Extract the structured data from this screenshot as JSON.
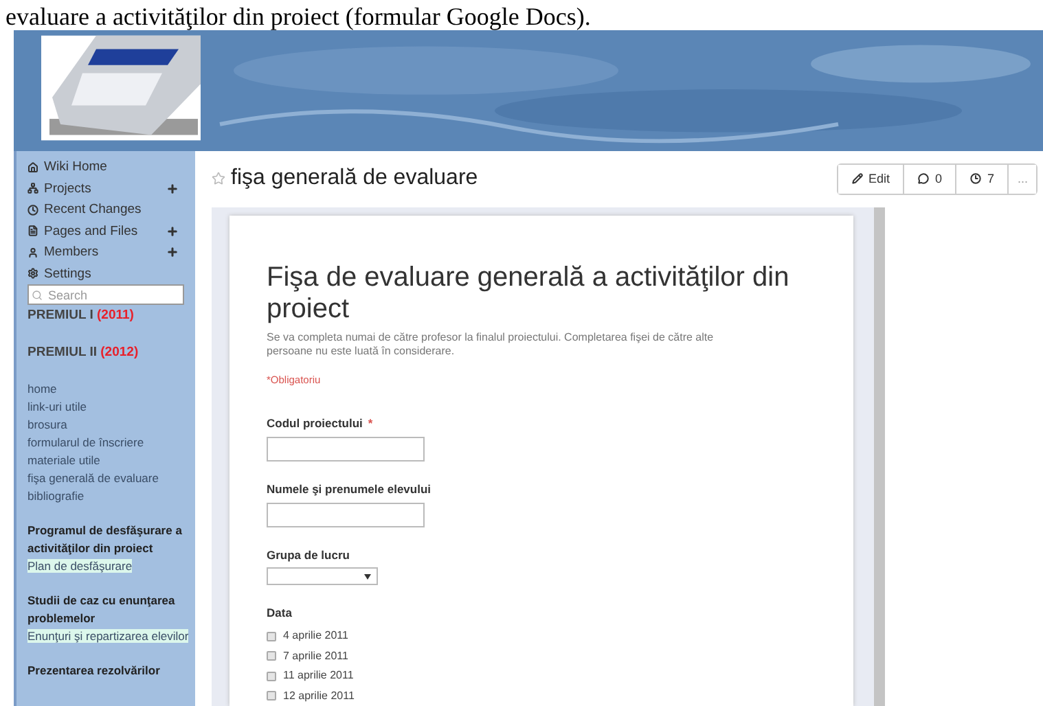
{
  "document_text": "evaluare a activităţilor din proiect (formular Google Docs).",
  "sidebar": {
    "nav": [
      {
        "kind": "home",
        "label": "Wiki Home",
        "expandable": false
      },
      {
        "kind": "projects",
        "label": "Projects",
        "expandable": true
      },
      {
        "kind": "changes",
        "label": "Recent Changes",
        "expandable": false
      },
      {
        "kind": "pages",
        "label": "Pages and Files",
        "expandable": true
      },
      {
        "kind": "members",
        "label": "Members",
        "expandable": true
      },
      {
        "kind": "settings",
        "label": "Settings",
        "expandable": false
      }
    ],
    "search": {
      "placeholder": "Search"
    },
    "awards": [
      {
        "label": "PREMIUL I",
        "year": "(2011)"
      },
      {
        "label": "PREMIUL II",
        "year": "(2012)"
      }
    ],
    "links": [
      "home",
      "link-uri utile",
      "brosura",
      "formularul de înscriere",
      "materiale utile",
      "fişa generală de evaluare",
      "bibliografie"
    ],
    "sections": [
      {
        "heading": "Programul de desfăşurare a activităţilor din proiect",
        "links": [
          "Plan de desfăşurare"
        ]
      },
      {
        "heading": "Studii de caz cu enunţarea problemelor",
        "links": [
          "Enunţuri şi repartizarea elevilor"
        ]
      },
      {
        "heading": "Prezentarea rezolvărilor"
      }
    ]
  },
  "page": {
    "title": "fişa generală de evaluare",
    "starred": false,
    "actions": [
      {
        "kind": "edit",
        "label": "Edit"
      },
      {
        "kind": "comments",
        "label": "0"
      },
      {
        "kind": "history",
        "label": "7"
      },
      {
        "kind": "more",
        "label": "..."
      }
    ]
  },
  "form": {
    "title": "Fişa de evaluare generală a activităţilor din proiect",
    "description": "Se va completa numai de către profesor la finalul proiectului. Completarea fişei de către alte persoane nu este luată în considerare.",
    "required_note": "*Obligatoriu",
    "required_mark": "*",
    "fields": [
      {
        "kind": "text",
        "label": "Codul proiectului",
        "required": true
      },
      {
        "kind": "text",
        "label": "Numele şi prenumele elevului",
        "required": false
      },
      {
        "kind": "select",
        "label": "Grupa de lucru",
        "required": false
      },
      {
        "kind": "checkboxes",
        "label": "Data",
        "required": false,
        "options": [
          {
            "label": "4 aprilie 2011",
            "checked": false
          },
          {
            "label": "7 aprilie 2011",
            "checked": false
          },
          {
            "label": "11 aprilie 2011",
            "checked": false
          },
          {
            "label": "12 aprilie 2011",
            "checked": false
          }
        ]
      }
    ]
  }
}
